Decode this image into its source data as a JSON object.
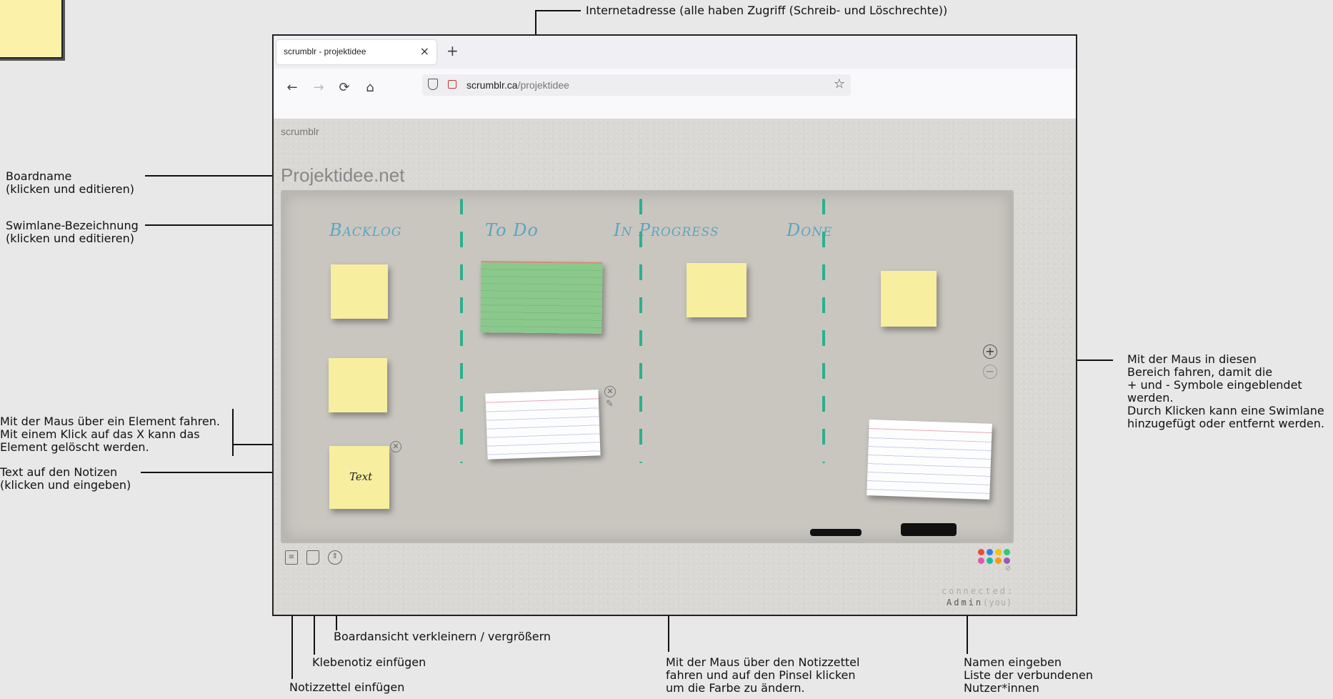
{
  "annotations": {
    "url_note": "Internetadresse (alle haben Zugriff (Schreib- und Löschrechte))",
    "boardname_note": [
      "Boardname",
      "(klicken und editieren)"
    ],
    "swimlane_note": [
      "Swimlane-Bezeichnung",
      "(klicken und editieren)"
    ],
    "delete_note": [
      "Mit der Maus über ein Element fahren.",
      "Mit einem Klick auf das X kann das",
      "Element gelöscht werden."
    ],
    "text_note": [
      "Text auf den Notizen",
      "(klicken und eingeben)"
    ],
    "lanes_note": [
      "Mit der Maus in diesen",
      "Bereich fahren, damit die",
      "+ und - Symbole eingeblendet",
      "werden.",
      "Durch Klicken kann eine Swimlane",
      "hinzugefügt oder entfernt werden."
    ],
    "zoom_note": "Boardansicht verkleinern / vergrößern",
    "sticky_note": "Klebenotiz einfügen",
    "card_note": "Notizzettel einfügen",
    "color_note": [
      "Mit der Maus über den Notizzettel",
      "fahren und auf den Pinsel klicken",
      "um die Farbe zu ändern."
    ],
    "name_note": [
      "Namen eingeben",
      "Liste der verbundenen",
      "Nutzer*innen"
    ]
  },
  "browser": {
    "tab_title": "scrumblr - projektidee",
    "tab_close": "×",
    "new_tab": "+",
    "url_host": "scrumblr.ca",
    "url_path": "/projektidee",
    "back": "←",
    "forward": "→",
    "reload": "⟳",
    "home": "⌂",
    "bookmark": "☆"
  },
  "app": {
    "brand": "scrumblr",
    "board_name": "Projektidee.net",
    "lanes": [
      "Backlog",
      "To Do",
      "In Progress",
      "Done"
    ],
    "note_text": "Text",
    "add_lane": "+",
    "remove_lane": "−",
    "connected_label": "connected:",
    "user_name": "Admin",
    "user_suffix": "(you)",
    "palette": [
      "#e74c3c",
      "#3b78e7",
      "#f1c40f",
      "#2ecc71",
      "#e056b8",
      "#1abc9c",
      "#f39c12",
      "#9b59b6"
    ]
  }
}
